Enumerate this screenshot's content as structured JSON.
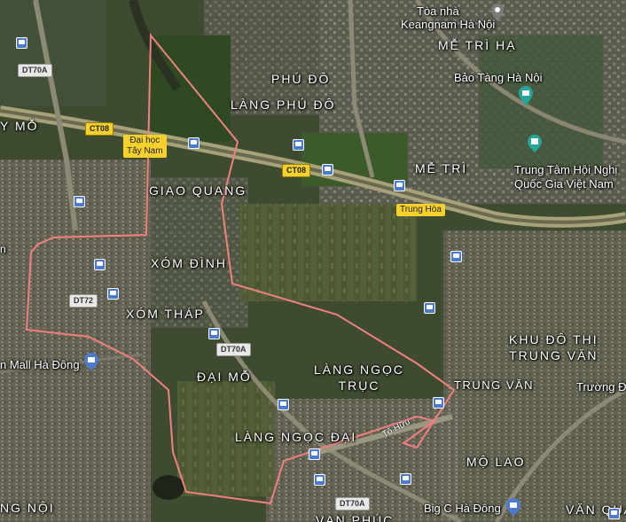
{
  "map": {
    "labels": {
      "keangnam": [
        "Tòa nhà",
        "Keangnam Hà Nội"
      ],
      "me_tri_ha": "MỄ TRÌ HẠ",
      "bao_tang": "Bảo Tàng Hà Nội",
      "phu_do": "PHÚ ĐÔ",
      "lang_phu_do": "LÀNG PHÚ ĐÔ",
      "me_tri": "MỄ TRÌ",
      "trung_tam_hoi_nghi": [
        "Trung Tâm Hội Nghị",
        "Quốc Gia Việt Nam"
      ],
      "giao_quang": "GIAO QUANG",
      "xom_dinh": "XÓM ĐÌNH",
      "xom_thap": "XÓM THÁP",
      "dai_mo": "ĐẠI MỖ",
      "lang_ngoc_truc": [
        "LÀNG NGỌC",
        "TRỤC"
      ],
      "lang_ngoc_dai": "LÀNG NGỌC ĐẠI",
      "trung_van": "TRUNG VĂN",
      "khu_do_thi": [
        "KHU ĐÔ THỊ",
        "TRUNG VĂN"
      ],
      "truong": "Trường Đ",
      "mo_lao": "MỘ LAO",
      "van_quan": "VĂN QUÁN",
      "van_phuc": "VẠN PHÚC",
      "big_c": "Big C Hà Đông",
      "aeon": "n Mall Hà Đông",
      "ng_noi": "NG NỘI",
      "y_mo": "Y MỖ",
      "dai_hoc": [
        "Đại học",
        "Tây Nam"
      ],
      "left_n": "n"
    },
    "shields": {
      "dt70a_top": "DT70A",
      "ct08_left": "CT08",
      "ct08_mid": "CT08",
      "dt72": "DT72",
      "dt70a_mid": "DT70A",
      "dt70a_bottom": "DT70A"
    },
    "roads": {
      "trung_hoa": "Trung Hòa",
      "to_huu": "Tố Hữu"
    },
    "colors": {
      "boundary": "#f08080",
      "road_yellow": "#f6d02b",
      "bus_icon": "#4a7bd0",
      "pin_gray": "#7a7a7a",
      "museum_teal": "#26a69a"
    }
  }
}
